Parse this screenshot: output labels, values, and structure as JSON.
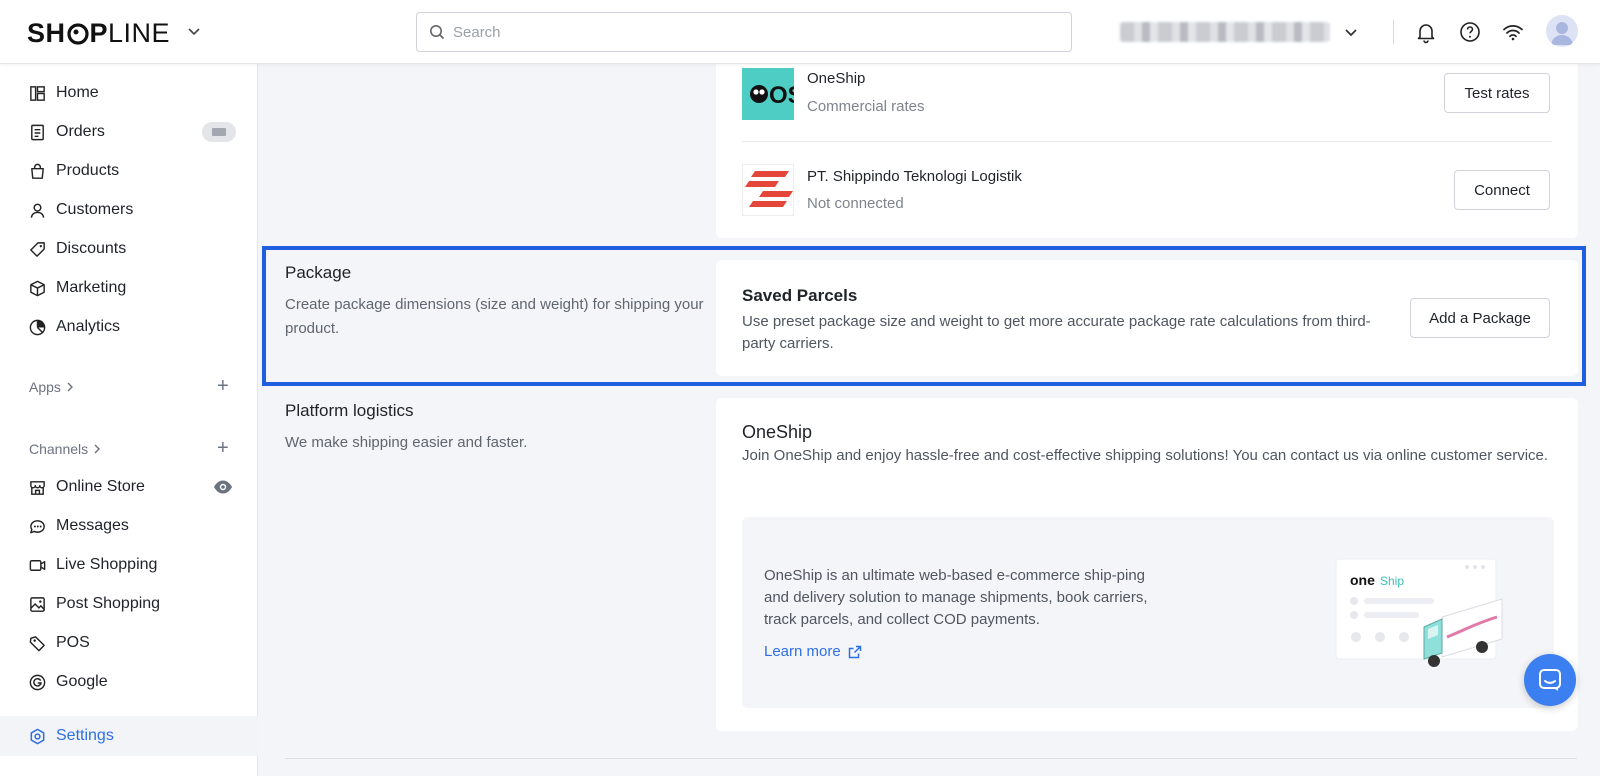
{
  "topbar": {
    "logo_bold_1": "SH",
    "logo_bold_2": "P",
    "logo_light": "LINE",
    "search_placeholder": "Search"
  },
  "sidebar": {
    "items": [
      {
        "label": "Home",
        "icon": "home-icon"
      },
      {
        "label": "Orders",
        "icon": "orders-icon"
      },
      {
        "label": "Products",
        "icon": "products-icon"
      },
      {
        "label": "Customers",
        "icon": "customers-icon"
      },
      {
        "label": "Discounts",
        "icon": "discounts-icon"
      },
      {
        "label": "Marketing",
        "icon": "marketing-icon"
      },
      {
        "label": "Analytics",
        "icon": "analytics-icon"
      }
    ],
    "apps_label": "Apps",
    "channels_label": "Channels",
    "channels": [
      {
        "label": "Online Store",
        "icon": "online-store-icon"
      },
      {
        "label": "Messages",
        "icon": "messages-icon"
      },
      {
        "label": "Live Shopping",
        "icon": "live-shopping-icon"
      },
      {
        "label": "Post Shopping",
        "icon": "post-shopping-icon"
      },
      {
        "label": "POS",
        "icon": "pos-icon"
      },
      {
        "label": "Google",
        "icon": "google-icon"
      }
    ],
    "settings_label": "Settings"
  },
  "carriers": [
    {
      "name": "OneShip",
      "status": "Commercial rates",
      "button": "Test rates",
      "logo_text": "OS"
    },
    {
      "name": "PT. Shippindo Teknologi Logistik",
      "status": "Not connected",
      "button": "Connect"
    }
  ],
  "package": {
    "title": "Package",
    "description": "Create package dimensions (size and weight) for shipping your product.",
    "card_title": "Saved Parcels",
    "card_description": "Use preset package size and weight to get more accurate package rate calculations from third-party carriers.",
    "button": "Add a Package"
  },
  "platform": {
    "title": "Platform logistics",
    "description": "We make shipping easier and faster.",
    "card_title": "OneShip",
    "card_description": "Join OneShip and enjoy hassle-free and cost-effective shipping solutions! You can contact us via online customer service.",
    "promo_text": "OneShip is an ultimate web-based e-commerce ship-ping and delivery solution to manage shipments, book carriers, track parcels, and collect COD payments.",
    "learn_more": "Learn more",
    "illustration_logo_1": "one",
    "illustration_logo_2": "Ship"
  },
  "colors": {
    "accent": "#2f6fe4",
    "highlight": "#1f5fe0",
    "oneship_teal": "#4ecdc4",
    "shippindo_red": "#e4473a"
  }
}
